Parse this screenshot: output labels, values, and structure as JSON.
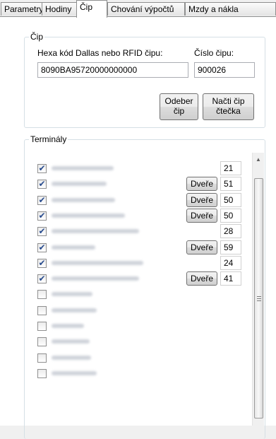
{
  "tabs": [
    {
      "label": "Parametry"
    },
    {
      "label": "Hodiny"
    },
    {
      "label": "Čip",
      "active": true
    },
    {
      "label": "Chování výpočtů"
    },
    {
      "label": "Mzdy a nákla"
    }
  ],
  "chip_group": {
    "legend": "Čip",
    "hex_label": "Hexa kód Dallas nebo RFID čipu:",
    "hex_value": "8090BA95720000000000",
    "number_label": "Číslo čipu:",
    "number_value": "900026",
    "remove_button": {
      "line1": "Odeber",
      "line2": "čip"
    },
    "read_button": {
      "line1": "Načti čip",
      "line2": "čtečka"
    }
  },
  "terminals": {
    "legend": "Terminály",
    "door_button_label": "Dveře",
    "items": [
      {
        "checked": true,
        "door": false,
        "number": "21"
      },
      {
        "checked": true,
        "door": true,
        "number": "51"
      },
      {
        "checked": true,
        "door": true,
        "number": "50"
      },
      {
        "checked": true,
        "door": true,
        "number": "50"
      },
      {
        "checked": true,
        "door": false,
        "number": "28"
      },
      {
        "checked": true,
        "door": true,
        "number": "59"
      },
      {
        "checked": true,
        "door": false,
        "number": "24"
      },
      {
        "checked": true,
        "door": true,
        "number": "41"
      },
      {
        "checked": false,
        "door": false,
        "number": ""
      },
      {
        "checked": false,
        "door": false,
        "number": ""
      },
      {
        "checked": false,
        "door": false,
        "number": ""
      },
      {
        "checked": false,
        "door": false,
        "number": ""
      },
      {
        "checked": false,
        "door": false,
        "number": ""
      },
      {
        "checked": false,
        "door": false,
        "number": ""
      }
    ]
  },
  "icons": {
    "check": "checkmark-icon",
    "scroll_up": "scroll-up-arrow-icon"
  }
}
